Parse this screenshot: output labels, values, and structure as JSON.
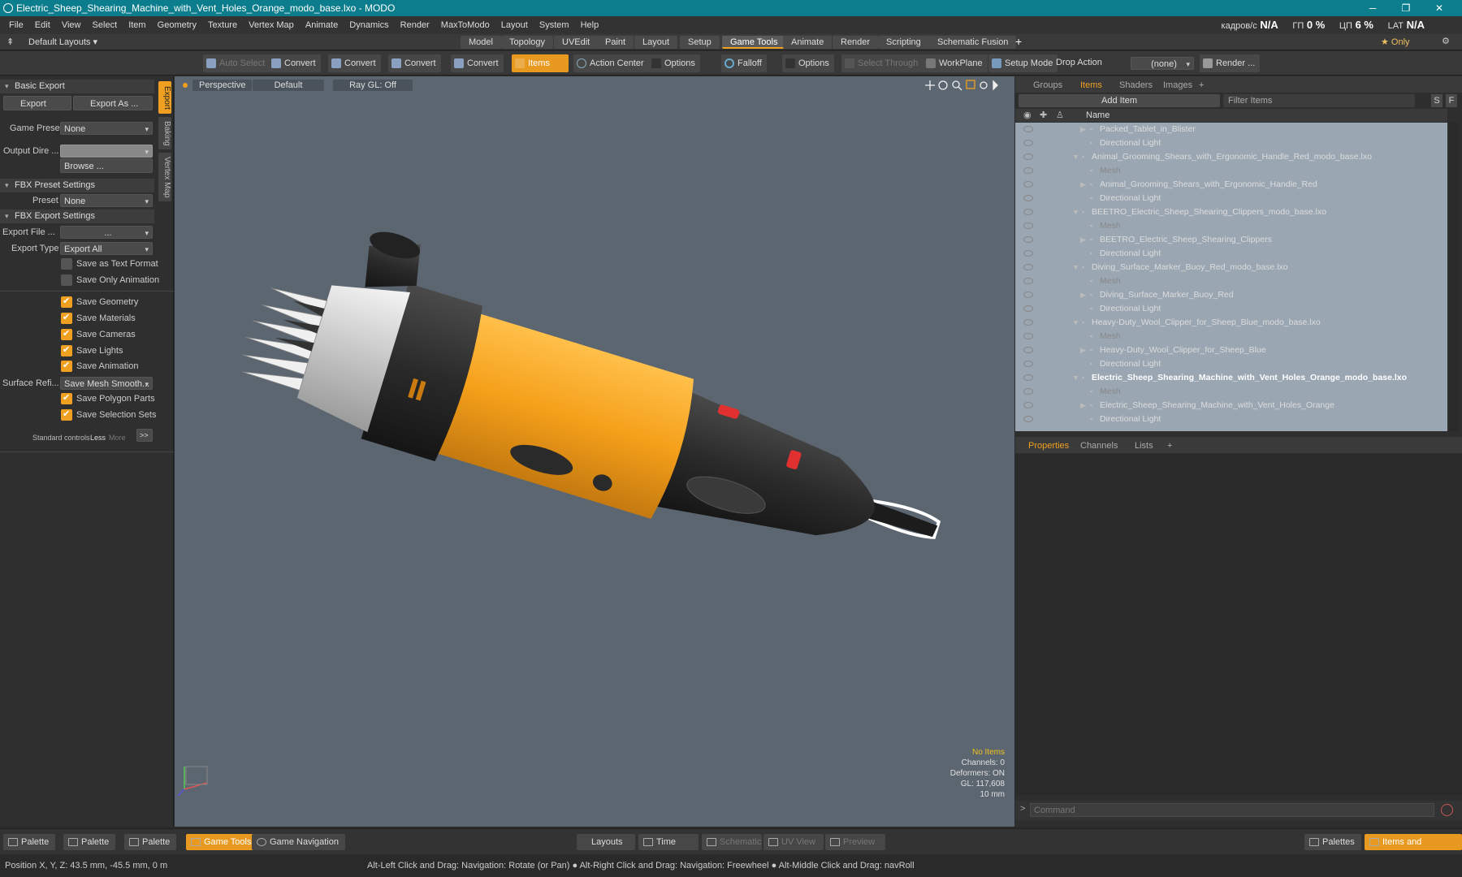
{
  "window": {
    "title": "Electric_Sheep_Shearing_Machine_with_Vent_Holes_Orange_modo_base.lxo - MODO",
    "minimize": "─",
    "maximize": "❐",
    "close": "✕"
  },
  "menu": [
    "File",
    "Edit",
    "View",
    "Select",
    "Item",
    "Geometry",
    "Texture",
    "Vertex Map",
    "Animate",
    "Dynamics",
    "Render",
    "MaxToModo",
    "Layout",
    "System",
    "Help"
  ],
  "stats": {
    "fps_label": "кадров/с",
    "fps_value": "N/A",
    "gpu_label": "ГП",
    "gpu_value": "0 %",
    "cpu_label": "ЦП",
    "cpu_value": "6 %",
    "lat_label": "LAT",
    "lat_value": "N/A"
  },
  "layouts": {
    "default_label": "Default Layouts ▾",
    "tabs": [
      "Model",
      "Topology",
      "UVEdit",
      "Paint",
      "Layout",
      "Setup",
      "Game Tools",
      "Animate",
      "Render",
      "Scripting",
      "Schematic Fusion"
    ],
    "active_tab": "Game Tools",
    "add": "+",
    "only_label": "★  Only",
    "gear": "⚙"
  },
  "toolbar": {
    "auto_select": "Auto Select",
    "convert1": "Convert",
    "convert2": "Convert",
    "convert3": "Convert",
    "convert4": "Convert",
    "items": "Items",
    "action_center": "Action Center",
    "options1": "Options",
    "falloff": "Falloff",
    "options2": "Options",
    "select_through": "Select Through",
    "workplane": "WorkPlane",
    "setup_mode": "Setup Mode",
    "drop_action_label": "Drop Action",
    "drop_action_value": "(none)",
    "render": "Render ..."
  },
  "left_panel": {
    "basic_export": "Basic Export",
    "export_btn": "Export",
    "export_as_btn": "Export As ...",
    "game_preset_label": "Game Preset",
    "game_preset_value": "None",
    "output_dir_label": "Output Dire ...",
    "output_dir_value": "",
    "browse": "Browse ...",
    "fbx_preset_settings": "FBX Preset Settings",
    "preset_label": "Preset",
    "preset_value": "None",
    "fbx_export_settings": "FBX Export Settings",
    "export_file_label": "Export File  ...",
    "export_file_value": "...",
    "export_type_label": "Export Type",
    "export_type_value": "Export All",
    "save_text_format": "Save as Text Format",
    "save_only_animation": "Save Only Animation",
    "save_geometry": "Save Geometry",
    "save_materials": "Save Materials",
    "save_cameras": "Save Cameras",
    "save_lights": "Save Lights",
    "save_animation": "Save Animation",
    "surface_refi_label": "Surface Refi...",
    "surface_refi_value": "Save Mesh Smooth...",
    "save_polygon_parts": "Save Polygon Parts",
    "save_selection_sets": "Save Selection Sets",
    "standard_controls": "Standard controls",
    "less": "Less",
    "more": "More",
    "expand": ">>",
    "vtab_export": "Export",
    "vtab_baking": "Baking",
    "vtab_vertexmap": "Vertex Map"
  },
  "viewport": {
    "perspective": "Perspective",
    "default": "Default",
    "raygl": "Ray GL: Off",
    "info_no_items": "No Items",
    "info_channels": "Channels: 0",
    "info_deformers": "Deformers: ON",
    "info_gl": "GL: 117,608",
    "info_scale": "10 mm"
  },
  "right_panel": {
    "tabs": [
      "Groups",
      "Items",
      "Shaders",
      "Images"
    ],
    "active_tab": "Items",
    "add_item": "Add Item",
    "filter_items": "Filter Items",
    "s_btn": "S",
    "f_btn": "F",
    "col_name": "Name",
    "tree": [
      {
        "name": "Packed_Tablet_in_Blister",
        "indent": 2,
        "arrow": "▶",
        "style": ""
      },
      {
        "name": "Directional Light",
        "indent": 2,
        "arrow": "",
        "style": ""
      },
      {
        "name": "Animal_Grooming_Shears_with_Ergonomic_Handle_Red_modo_base.lxo",
        "indent": 1,
        "arrow": "▼",
        "style": ""
      },
      {
        "name": "Mesh",
        "indent": 2,
        "arrow": "",
        "style": "grey"
      },
      {
        "name": "Animal_Grooming_Shears_with_Ergonomic_Handle_Red",
        "indent": 2,
        "arrow": "▶",
        "style": ""
      },
      {
        "name": "Directional Light",
        "indent": 2,
        "arrow": "",
        "style": ""
      },
      {
        "name": "BEETRO_Electric_Sheep_Shearing_Clippers_modo_base.lxo",
        "indent": 1,
        "arrow": "▼",
        "style": ""
      },
      {
        "name": "Mesh",
        "indent": 2,
        "arrow": "",
        "style": "grey"
      },
      {
        "name": "BEETRO_Electric_Sheep_Shearing_Clippers",
        "indent": 2,
        "arrow": "▶",
        "style": ""
      },
      {
        "name": "Directional Light",
        "indent": 2,
        "arrow": "",
        "style": ""
      },
      {
        "name": "Diving_Surface_Marker_Buoy_Red_modo_base.lxo",
        "indent": 1,
        "arrow": "▼",
        "style": ""
      },
      {
        "name": "Mesh",
        "indent": 2,
        "arrow": "",
        "style": "grey"
      },
      {
        "name": "Diving_Surface_Marker_Buoy_Red",
        "indent": 2,
        "arrow": "▶",
        "style": ""
      },
      {
        "name": "Directional Light",
        "indent": 2,
        "arrow": "",
        "style": ""
      },
      {
        "name": "Heavy-Duty_Wool_Clipper_for_Sheep_Blue_modo_base.lxo",
        "indent": 1,
        "arrow": "▼",
        "style": ""
      },
      {
        "name": "Mesh",
        "indent": 2,
        "arrow": "",
        "style": "grey"
      },
      {
        "name": "Heavy-Duty_Wool_Clipper_for_Sheep_Blue",
        "indent": 2,
        "arrow": "▶",
        "style": ""
      },
      {
        "name": "Directional Light",
        "indent": 2,
        "arrow": "",
        "style": ""
      },
      {
        "name": "Electric_Sheep_Shearing_Machine_with_Vent_Holes_Orange_modo_base.lxo",
        "indent": 1,
        "arrow": "▼",
        "style": "bold"
      },
      {
        "name": "Mesh",
        "indent": 2,
        "arrow": "",
        "style": "grey"
      },
      {
        "name": "Electric_Sheep_Shearing_Machine_with_Vent_Holes_Orange",
        "indent": 2,
        "arrow": "▶",
        "style": ""
      },
      {
        "name": "Directional Light",
        "indent": 2,
        "arrow": "",
        "style": ""
      }
    ],
    "prop_tabs": [
      "Properties",
      "Channels",
      "Lists"
    ],
    "prop_active": "Properties",
    "command_placeholder": "Command"
  },
  "bottom_bar": {
    "palette1": "Palette",
    "palette2": "Palette",
    "palette3": "Palette",
    "game_tools": "Game Tools",
    "game_navigation": "Game Navigation",
    "layouts": "Layouts",
    "time": "Time",
    "schematic": "Schematic",
    "uv_view": "UV View",
    "preview": "Preview",
    "palettes": "Palettes",
    "items_and_shading": "Items and Shading"
  },
  "status": {
    "position": "Position X, Y, Z:  43.5 mm, -45.5 mm, 0 m",
    "hint": "Alt-Left Click and Drag: Navigation: Rotate (or Pan) ● Alt-Right Click and Drag: Navigation: Freewheel ● Alt-Middle Click and Drag: navRoll"
  },
  "colors": {
    "accent": "#f0a020",
    "titlebar": "#0b7d8c",
    "viewport_bg": "#5c6670",
    "model_orange": "#f5a01a"
  }
}
